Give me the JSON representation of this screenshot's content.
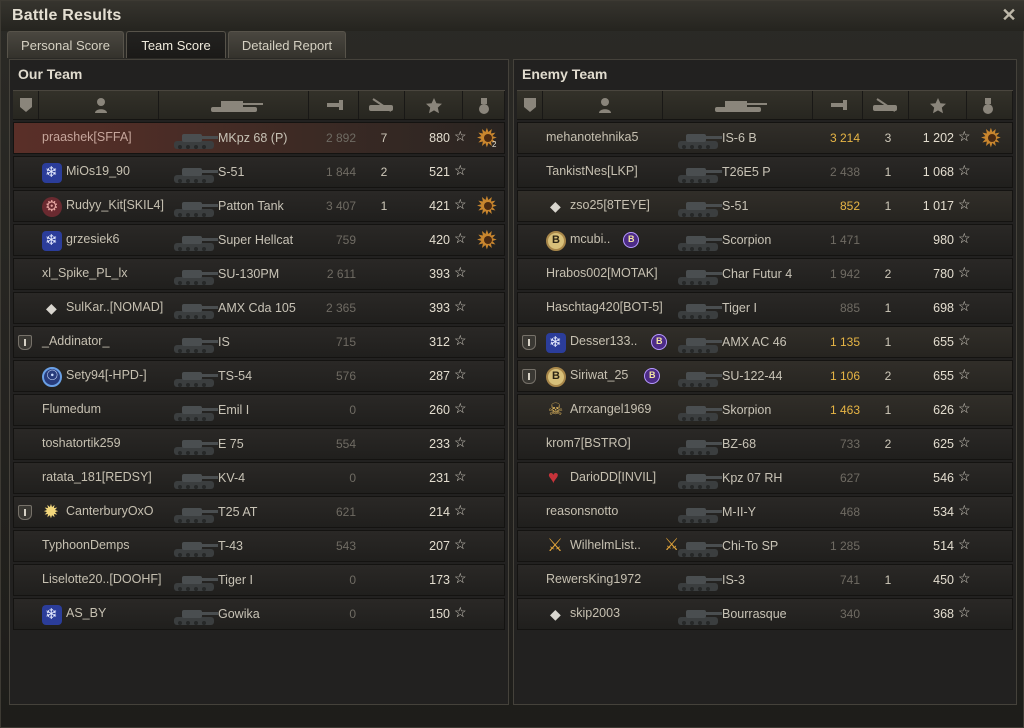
{
  "window": {
    "title": "Battle Results",
    "close_icon": "close-icon"
  },
  "tabs": [
    {
      "label": "Personal Score",
      "active": false
    },
    {
      "label": "Team Score",
      "active": true
    },
    {
      "label": "Detailed Report",
      "active": false
    }
  ],
  "colors": {
    "own_player_row": "#5a2f28",
    "gold_damage": "#e7b545",
    "background": "#222120"
  },
  "columns": [
    "platoon-icon",
    "player-icon",
    "tank-icon",
    "damage-icon",
    "kills-icon",
    "xp-star-icon",
    "medal-icon"
  ],
  "our_team": {
    "title": "Our Team",
    "players": [
      {
        "name": "praashek[SFFA]",
        "tank": "MKpz 68 (P)",
        "damage": "2 892",
        "kills": "7",
        "xp": "880",
        "medal": true,
        "medal_count": "2",
        "me": true
      },
      {
        "name": "MiOs19_90",
        "clan_icon": "snow",
        "tank": "S-51",
        "damage": "1 844",
        "kills": "2",
        "xp": "521"
      },
      {
        "name": "Rudyy_Kit[SKIL4]",
        "clan_icon": "gear",
        "tank": "Patton Tank",
        "damage": "3 407",
        "kills": "1",
        "xp": "421",
        "medal": true
      },
      {
        "name": "grzesiek6",
        "clan_icon": "snow",
        "tank": "Super Hellcat",
        "damage": "759",
        "kills": "",
        "xp": "420",
        "medal": true
      },
      {
        "name": "xl_Spike_PL_lx",
        "tank": "SU-130PM",
        "damage": "2 611",
        "kills": "",
        "xp": "393"
      },
      {
        "name": "SulKar..[NOMAD]",
        "clan_icon": "diamond",
        "tank": "AMX Cda 105",
        "damage": "2 365",
        "kills": "",
        "xp": "393"
      },
      {
        "name": "_Addinator_",
        "platoon": true,
        "tank": "IS",
        "damage": "715",
        "kills": "",
        "xp": "312"
      },
      {
        "name": "Sety94[-HPD-]",
        "clan_icon": "circle",
        "tank": "TS-54",
        "damage": "576",
        "kills": "",
        "xp": "287"
      },
      {
        "name": "Flumedum",
        "tank": "Emil I",
        "damage": "0",
        "kills": "",
        "xp": "260"
      },
      {
        "name": "toshatortik259",
        "tank": "E 75",
        "damage": "554",
        "kills": "",
        "xp": "233"
      },
      {
        "name": "ratata_181[REDSY]",
        "tank": "KV-4",
        "damage": "0",
        "kills": "",
        "xp": "231"
      },
      {
        "name": "CanterburyOxO",
        "platoon": true,
        "clan_icon": "star",
        "tank": "T25 AT",
        "damage": "621",
        "kills": "",
        "xp": "214"
      },
      {
        "name": "TyphoonDemps",
        "tank": "T-43",
        "damage": "543",
        "kills": "",
        "xp": "207"
      },
      {
        "name": "Liselotte20..[DOOHF]",
        "tank": "Tiger I",
        "damage": "0",
        "kills": "",
        "xp": "173"
      },
      {
        "name": "AS_BY",
        "clan_icon": "snow",
        "tank": "Gowika",
        "damage": "0",
        "kills": "",
        "xp": "150"
      }
    ]
  },
  "enemy_team": {
    "title": "Enemy Team",
    "players": [
      {
        "name": "mehanotehnika5",
        "tank": "IS-6 B",
        "damage": "3 214",
        "gold": true,
        "kills": "3",
        "xp": "1 202",
        "medal": true,
        "hl": true
      },
      {
        "name": "TankistNes[LKP]",
        "tank": "T26E5 P",
        "damage": "2 438",
        "kills": "1",
        "xp": "1 068"
      },
      {
        "name": "zso25[8TEYE]",
        "clan_icon": "diamond",
        "tank": "S-51",
        "damage": "852",
        "gold": true,
        "kills": "1",
        "xp": "1 017",
        "hl": true
      },
      {
        "name": "mcubi..",
        "clan_icon": "b",
        "badge": true,
        "tank": "Scorpion",
        "damage": "1 471",
        "kills": "",
        "xp": "980"
      },
      {
        "name": "Hrabos002[MOTAK]",
        "tank": "Char Futur 4",
        "damage": "1 942",
        "kills": "2",
        "xp": "780"
      },
      {
        "name": "Haschtag420[BOT-5]",
        "tank": "Tiger I",
        "damage": "885",
        "kills": "1",
        "xp": "698"
      },
      {
        "name": "Desser133..",
        "platoon": true,
        "clan_icon": "snow",
        "badge": true,
        "tank": "AMX AC 46",
        "damage": "1 135",
        "gold": true,
        "kills": "1",
        "xp": "655",
        "hl": true
      },
      {
        "name": "Siriwat_25",
        "platoon": true,
        "clan_icon": "b",
        "badge": true,
        "tank": "SU-122-44",
        "damage": "1 106",
        "gold": true,
        "kills": "2",
        "xp": "655",
        "hl": true
      },
      {
        "name": "Arrxangel1969",
        "clan_icon": "skull",
        "tank": "Skorpion",
        "damage": "1 463",
        "gold": true,
        "kills": "1",
        "xp": "626",
        "hl": true
      },
      {
        "name": "krom7[BSTRO]",
        "tank": "BZ-68",
        "damage": "733",
        "kills": "2",
        "xp": "625"
      },
      {
        "name": "DarioDD[INVIL]",
        "clan_icon": "heart",
        "tank": "Kpz 07 RH",
        "damage": "627",
        "kills": "",
        "xp": "546"
      },
      {
        "name": "reasonsnotto",
        "tank": "M-II-Y",
        "damage": "468",
        "kills": "",
        "xp": "534"
      },
      {
        "name": "WilhelmList..",
        "clan_icon": "wolf",
        "badge3": true,
        "tank": "Chi-To SP",
        "damage": "1 285",
        "kills": "",
        "xp": "514"
      },
      {
        "name": "RewersKing1972",
        "tank": "IS-3",
        "damage": "741",
        "kills": "1",
        "xp": "450"
      },
      {
        "name": "skip2003",
        "clan_icon": "diamond",
        "tank": "Bourrasque",
        "damage": "340",
        "kills": "",
        "xp": "368"
      }
    ]
  }
}
